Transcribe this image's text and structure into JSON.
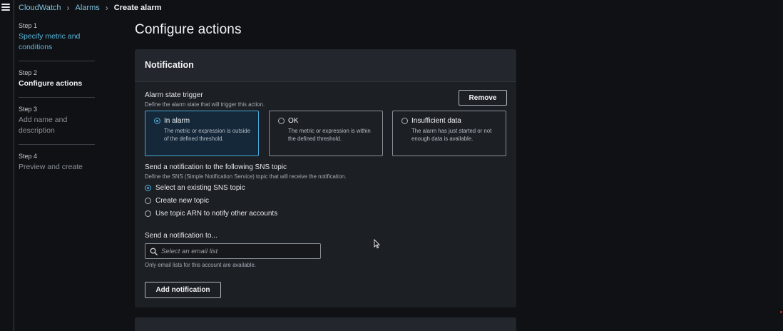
{
  "breadcrumb": {
    "items": [
      "CloudWatch",
      "Alarms"
    ],
    "current": "Create alarm"
  },
  "steps": [
    {
      "number": "Step 1",
      "title": "Specify metric and conditions",
      "state": "link"
    },
    {
      "number": "Step 2",
      "title": "Configure actions",
      "state": "active"
    },
    {
      "number": "Step 3",
      "title": "Add name and description",
      "state": "disabled"
    },
    {
      "number": "Step 4",
      "title": "Preview and create",
      "state": "disabled"
    }
  ],
  "page": {
    "title": "Configure actions"
  },
  "notification": {
    "title": "Notification",
    "remove_label": "Remove",
    "trigger": {
      "label": "Alarm state trigger",
      "description": "Define the alarm state that will trigger this action.",
      "options": [
        {
          "label": "In alarm",
          "description": "The metric or expression is outside of the defined threshold.",
          "selected": true
        },
        {
          "label": "OK",
          "description": "The metric or expression is within the defined threshold.",
          "selected": false
        },
        {
          "label": "Insufficient data",
          "description": "The alarm has just started or not enough data is available.",
          "selected": false
        }
      ]
    },
    "sns": {
      "label": "Send a notification to the following SNS topic",
      "description": "Define the SNS (Simple Notification Service) topic that will receive the notification.",
      "options": [
        {
          "label": "Select an existing SNS topic",
          "selected": true
        },
        {
          "label": "Create new topic",
          "selected": false
        },
        {
          "label": "Use topic ARN to notify other accounts",
          "selected": false
        }
      ]
    },
    "send_to": {
      "label": "Send a notification to...",
      "placeholder": "Select an email list",
      "value": "",
      "hint": "Only email lists for this account are available."
    },
    "add_label": "Add notification"
  },
  "colors": {
    "accent": "#4aa8d6",
    "link": "#58b8df",
    "background": "#0f1114",
    "panel": "#1c1f24"
  },
  "icons": {
    "menu": "hamburger-icon",
    "separator": "chevron-right-icon",
    "search": "search-icon",
    "cursor": "mouse-pointer-icon"
  }
}
